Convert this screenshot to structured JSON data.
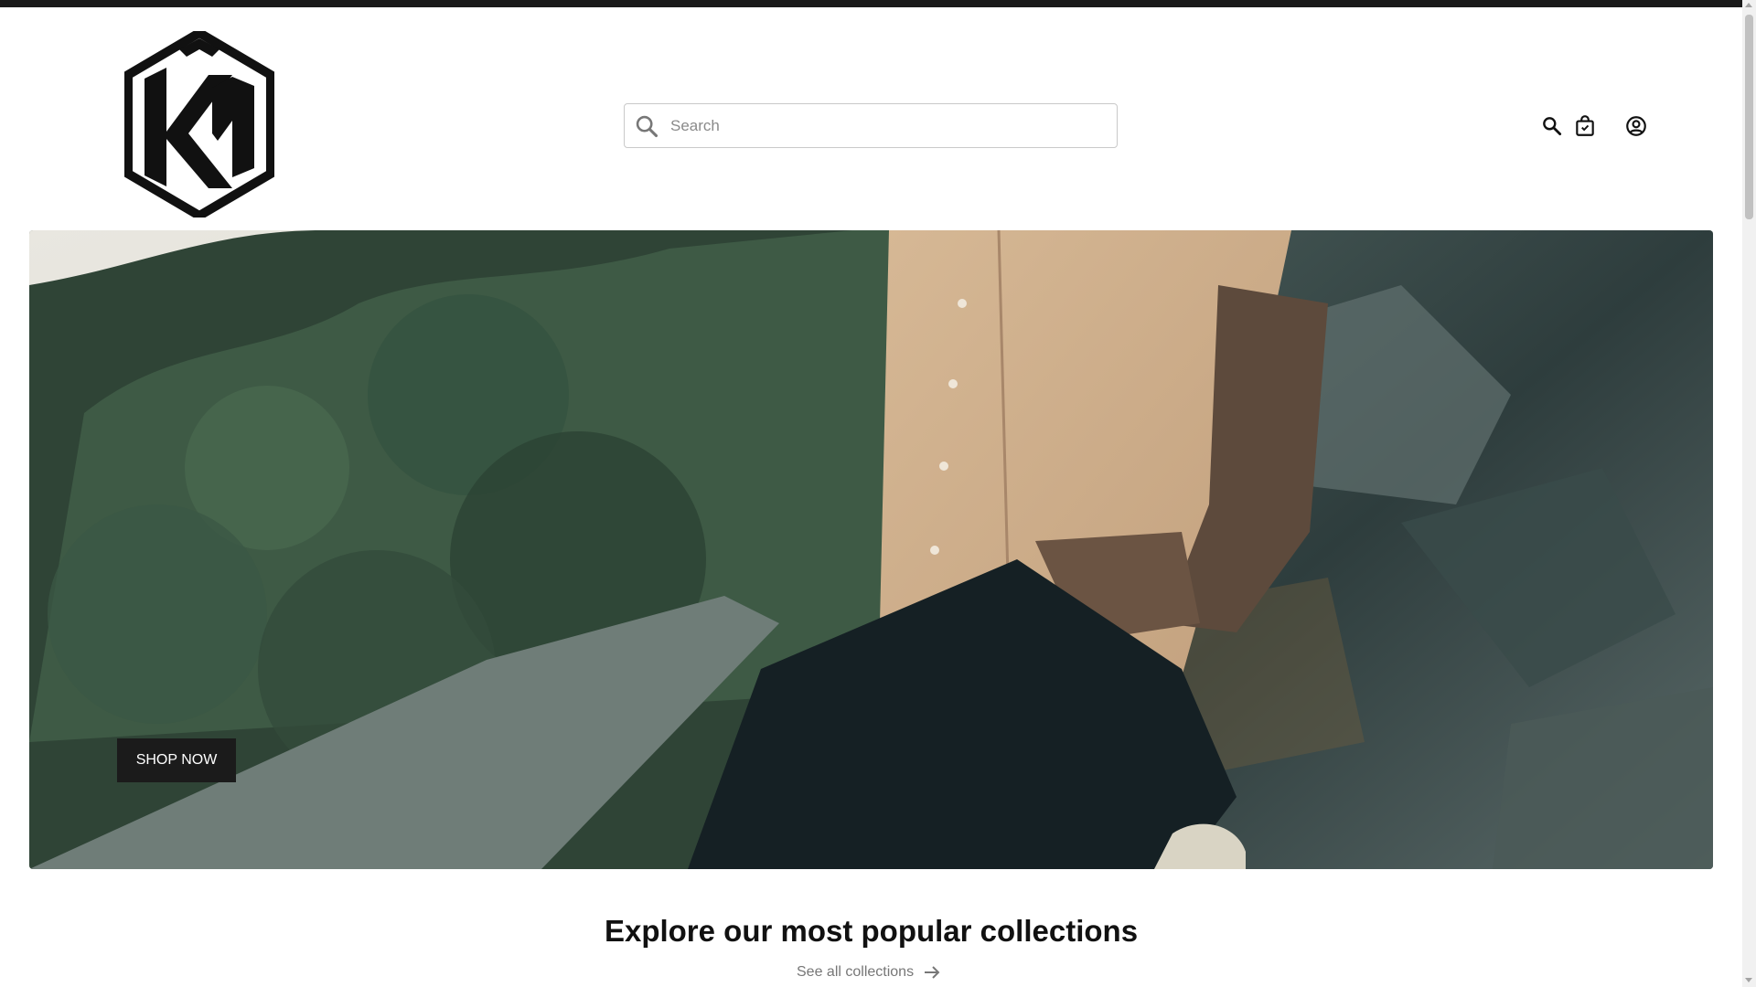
{
  "brand": {
    "logo_text": "KN"
  },
  "search": {
    "placeholder": "Search"
  },
  "header_icons": [
    "search-icon",
    "shopping-bag-icon",
    "account-icon"
  ],
  "hero": {
    "cta_label": "SHOP NOW"
  },
  "collections": {
    "title": "Explore our most popular collections",
    "see_all_label": "See all collections"
  },
  "colors": {
    "topbar": "#1a1a1a",
    "cta_bg": "#1b1b1b",
    "link": "#777777"
  }
}
